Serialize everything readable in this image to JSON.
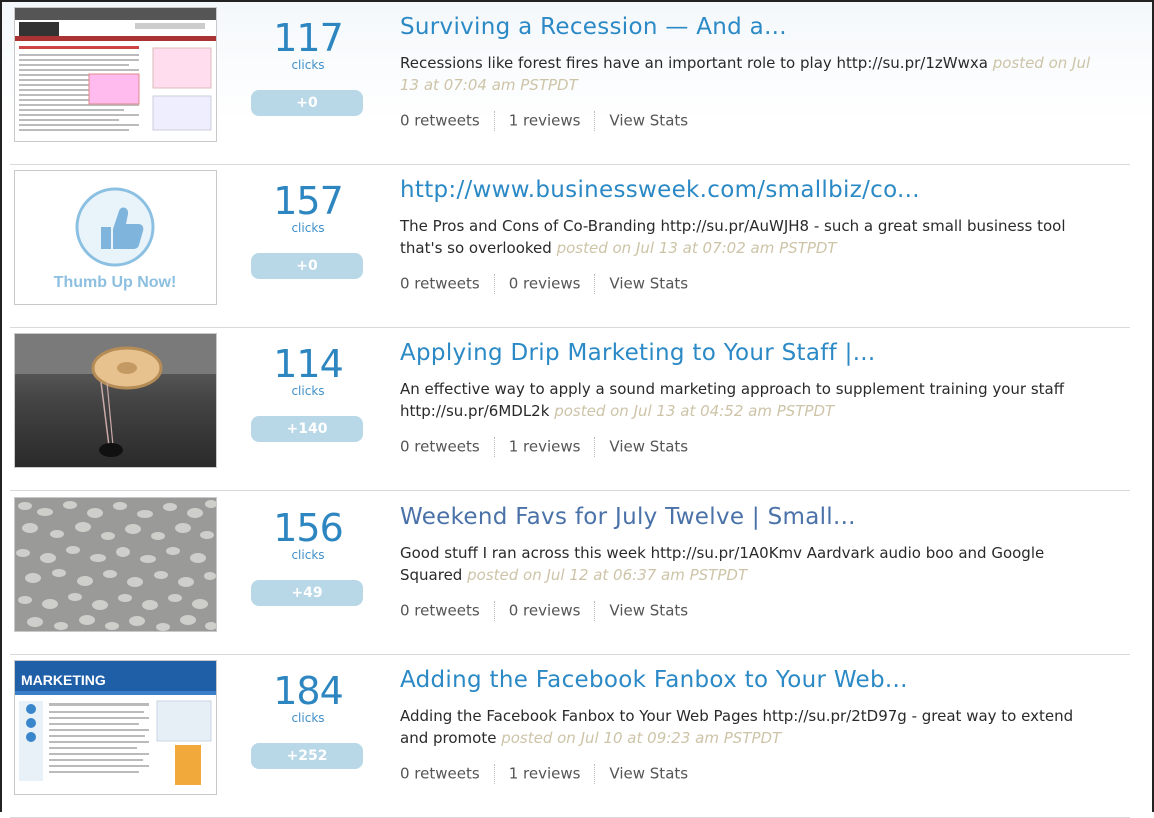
{
  "items": [
    {
      "clicks": "117",
      "clicks_label": "clicks",
      "delta": "+0",
      "title": "Surviving a Recession — And a...",
      "desc": "Recessions like forest fires have an important role to play http://su.pr/1zWwxa",
      "posted": "posted on Jul 13 at 07:04 am PSTPDT",
      "retweets": "0 retweets",
      "reviews": "1 reviews",
      "view_stats": "View Stats",
      "thumb": "webpage-screenshot"
    },
    {
      "clicks": "157",
      "clicks_label": "clicks",
      "delta": "+0",
      "title": "http://www.businessweek.com/smallbiz/co...",
      "desc": "The Pros and Cons of Co-Branding http://su.pr/AuWJH8 - such a great small business tool that's so overlooked",
      "posted": "posted on Jul 13 at 07:02 am PSTPDT",
      "retweets": "0 retweets",
      "reviews": "0 reviews",
      "view_stats": "View Stats",
      "thumb": "thumb-up",
      "thumb_text": "Thumb Up Now!"
    },
    {
      "clicks": "114",
      "clicks_label": "clicks",
      "delta": "+140",
      "title": "Applying Drip Marketing to Your Staff |...",
      "desc": "An effective way to apply a sound marketing approach to supplement training your staff http://su.pr/6MDL2k",
      "posted": "posted on Jul 13 at 04:52 am PSTPDT",
      "retweets": "0 retweets",
      "reviews": "1 reviews",
      "view_stats": "View Stats",
      "thumb": "faucet-photo"
    },
    {
      "clicks": "156",
      "clicks_label": "clicks",
      "delta": "+49",
      "title": "Weekend Favs for July Twelve | Small...",
      "desc": "Good stuff I ran across this week http://su.pr/1A0Kmv Aardvark audio boo and Google Squared",
      "posted": "posted on Jul 12 at 06:37 am PSTPDT",
      "retweets": "0 retweets",
      "reviews": "0 reviews",
      "view_stats": "View Stats",
      "thumb": "pebbles-photo"
    },
    {
      "clicks": "184",
      "clicks_label": "clicks",
      "delta": "+252",
      "title": "Adding the Facebook Fanbox to Your Web...",
      "desc": "Adding the Facebook Fanbox to Your Web Pages http://su.pr/2tD97g - great way to extend and promote",
      "posted": "posted on Jul 10 at 09:23 am PSTPDT",
      "retweets": "0 retweets",
      "reviews": "1 reviews",
      "view_stats": "View Stats",
      "thumb": "webpage-screenshot-blue",
      "thumb_logo": "MARKETING"
    }
  ]
}
